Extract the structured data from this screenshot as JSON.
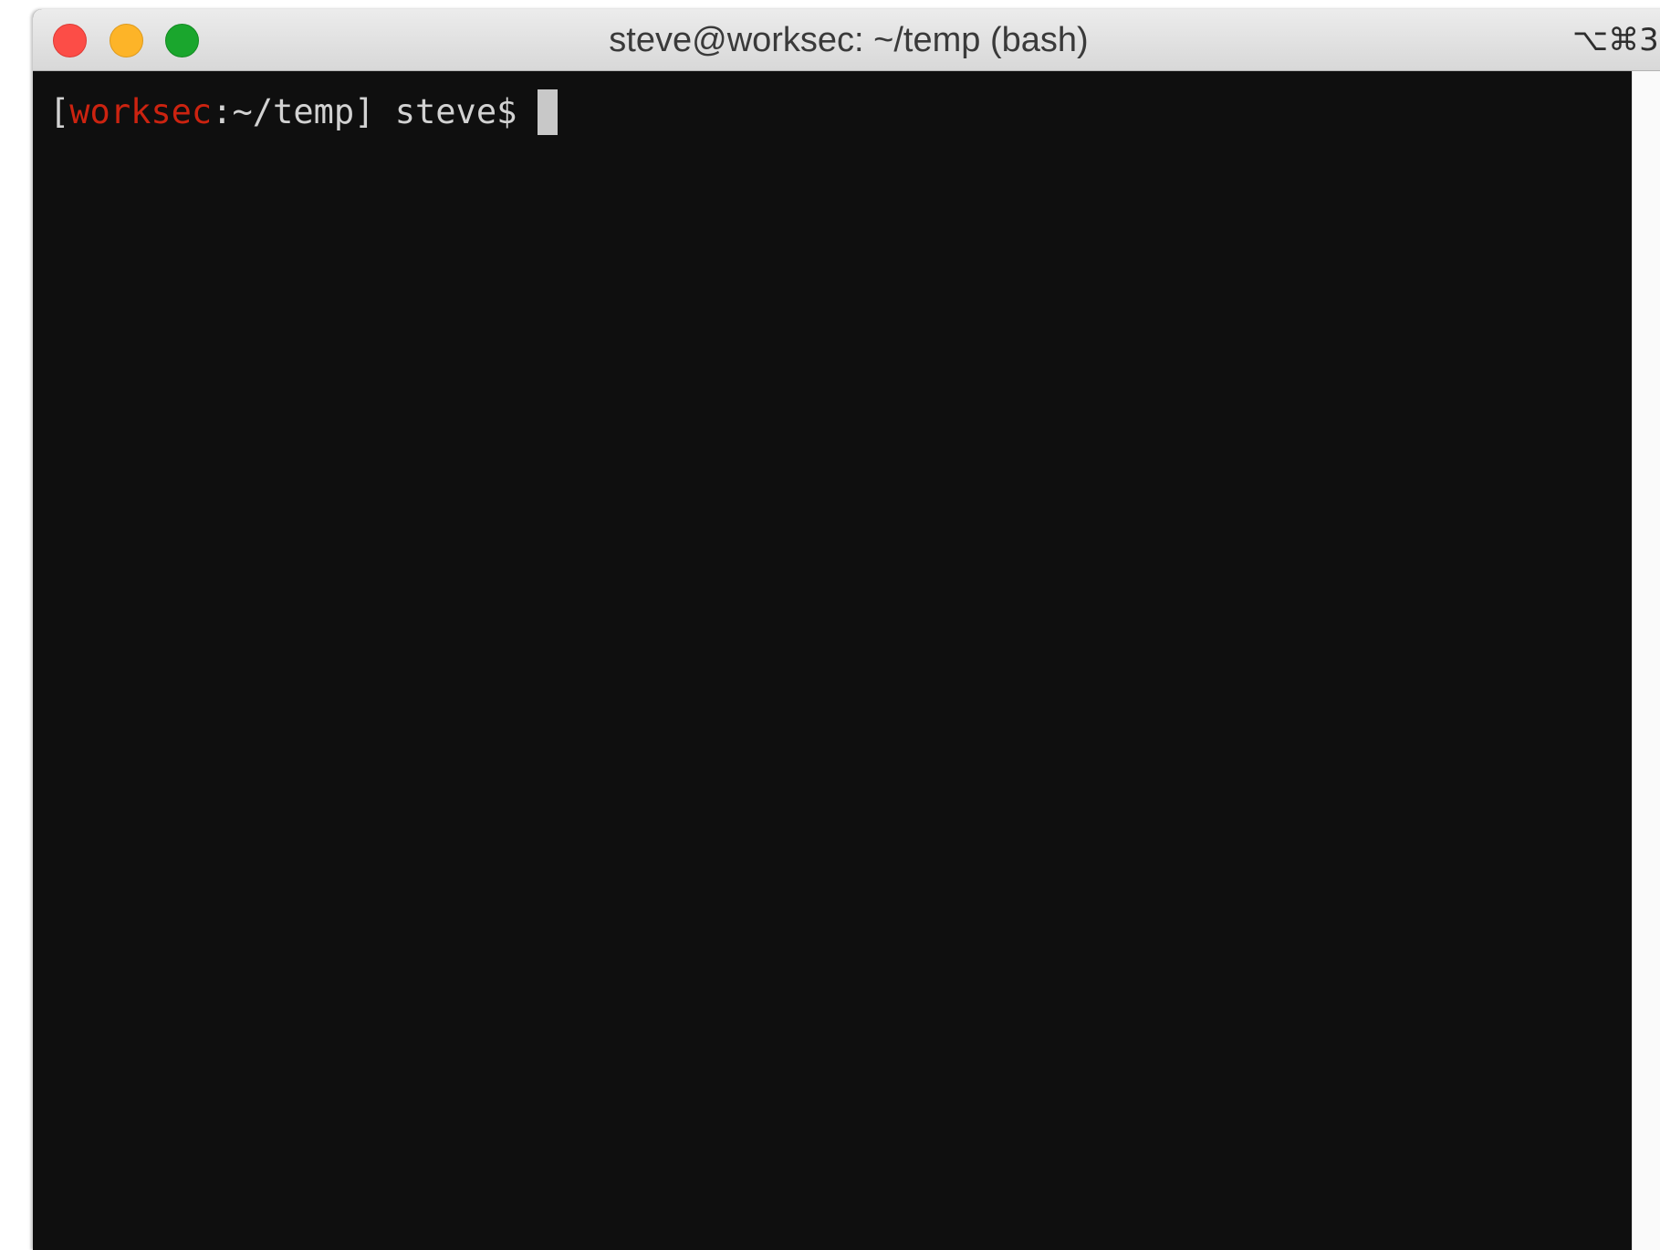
{
  "window": {
    "title": "steve@worksec: ~/temp (bash)",
    "shortcut": "⌥⌘3"
  },
  "terminal": {
    "prompt_open_bracket": "[",
    "prompt_host": "worksec",
    "prompt_path": ":~/temp]",
    "prompt_user": " steve$ "
  },
  "colors": {
    "background": "#0f0f0f",
    "foreground": "#d2d2d2",
    "host": "#cc2310",
    "traffic_close": "#fc4d47",
    "traffic_minimize": "#fdb428",
    "traffic_zoom": "#1aa62d"
  }
}
